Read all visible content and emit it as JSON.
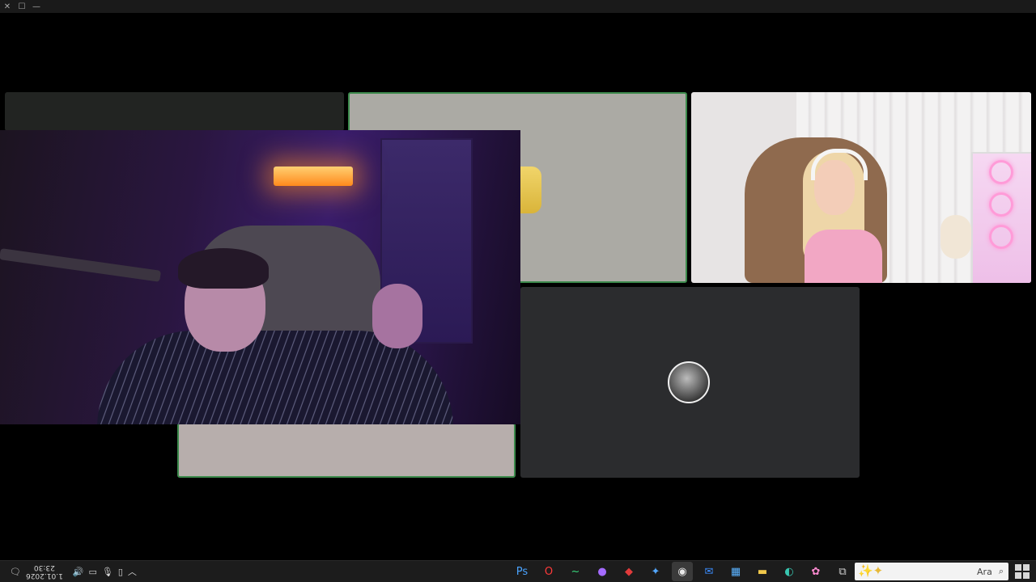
{
  "window": {
    "controls": [
      "close-icon",
      "maximize-icon",
      "minimize-icon"
    ]
  },
  "taskbar": {
    "clock_time": "23:30",
    "clock_date": "1.01.2026",
    "tray_icons": [
      "notification-icon",
      "volume-icon",
      "display-icon",
      "microphone-icon",
      "tablet-icon",
      "chevron-up-icon"
    ],
    "apps": [
      {
        "name": "app-ps",
        "glyph": "Ps",
        "color": "#4aa3ff"
      },
      {
        "name": "opera-icon",
        "glyph": "O",
        "color": "#ff3a3a"
      },
      {
        "name": "terminal-icon",
        "glyph": "~",
        "color": "#38d67c"
      },
      {
        "name": "messenger-icon",
        "glyph": "●",
        "color": "#a46bff"
      },
      {
        "name": "game-icon",
        "glyph": "◆",
        "color": "#e23b3b"
      },
      {
        "name": "network-icon",
        "glyph": "✦",
        "color": "#53a7ff"
      },
      {
        "name": "obs-icon",
        "glyph": "◉",
        "color": "#e8e8e8"
      },
      {
        "name": "mail-icon",
        "glyph": "✉",
        "color": "#3b8dff"
      },
      {
        "name": "store-icon",
        "glyph": "▦",
        "color": "#5ab2ff"
      },
      {
        "name": "file-explorer-icon",
        "glyph": "▬",
        "color": "#f1c84b"
      },
      {
        "name": "edge-icon",
        "glyph": "◐",
        "color": "#38c6b0"
      },
      {
        "name": "copilot-icon",
        "glyph": "✿",
        "color": "#ff8ad0"
      },
      {
        "name": "task-view-icon",
        "glyph": "⧉",
        "color": "#d0d0d0"
      }
    ],
    "search_label": "Ara"
  }
}
